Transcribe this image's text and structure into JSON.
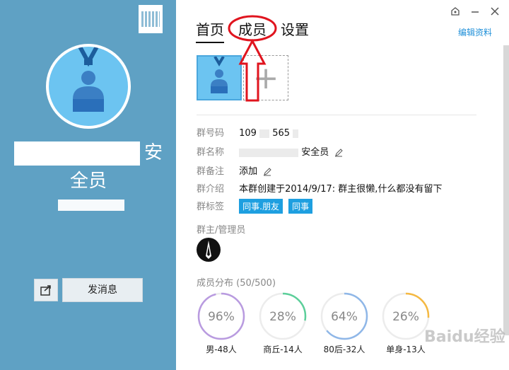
{
  "left": {
    "group_name_tail": "安",
    "group_name_line2": "全员",
    "send_label": "发消息"
  },
  "tabs": [
    {
      "label": "首页",
      "active": true
    },
    {
      "label": "成员",
      "active": false
    },
    {
      "label": "设置",
      "active": false
    }
  ],
  "edit_label": "编辑资料",
  "info": {
    "number_label": "群号码",
    "number_value": "109",
    "number_tail": "565",
    "name_label": "群名称",
    "name_value": "安全员",
    "remark_label": "群备注",
    "remark_value": "添加",
    "intro_label": "群介绍",
    "intro_value": "本群创建于2014/9/17:  群主很懒,什么都没有留下",
    "tags_label": "群标签",
    "tags": [
      "同事.朋友",
      "同事"
    ]
  },
  "admins_title": "群主/管理员",
  "distribution_title": "成员分布 (50/500)",
  "gauges": [
    {
      "percent_text": "96%",
      "percent": 96,
      "label": "男-48人",
      "color": "#b99be0"
    },
    {
      "percent_text": "28%",
      "percent": 28,
      "label": "商丘-14人",
      "color": "#5ccf9a"
    },
    {
      "percent_text": "64%",
      "percent": 64,
      "label": "80后-32人",
      "color": "#8fb7e8"
    },
    {
      "percent_text": "26%",
      "percent": 26,
      "label": "单身-13人",
      "color": "#f5b942"
    }
  ],
  "watermark": "Baidu经验"
}
